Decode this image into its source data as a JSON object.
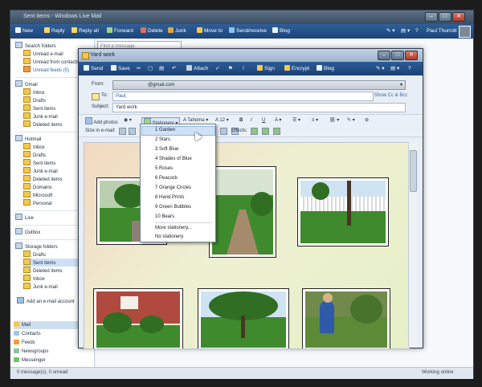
{
  "main_window": {
    "title": "Sent items - Windows Live Mail",
    "toolbar": [
      "New",
      "Reply",
      "Reply all",
      "Forward",
      "Delete",
      "Junk",
      "Move to",
      "Send/receive",
      "Blog"
    ],
    "user_name": "Paul Thurrott",
    "find_placeholder": "Find a message"
  },
  "sidebar": {
    "top": [
      "Search folders",
      "Unread e-mail",
      "Unread from contacts",
      "Unread feeds (5)"
    ],
    "gmail": [
      "Gmail",
      "Inbox",
      "Drafts",
      "Sent items",
      "Junk e-mail",
      "Deleted items"
    ],
    "hotmail": [
      "Hotmail",
      "Inbox",
      "Drafts",
      "Sent items",
      "Junk e-mail",
      "Deleted items",
      "Domains",
      "Microsoft",
      "Personal"
    ],
    "live": "Live",
    "outbox": "Outbox",
    "storage": [
      "Storage folders",
      "Drafts",
      "Sent items",
      "Deleted items",
      "Inbox",
      "Junk e-mail"
    ],
    "add_account": "Add an e-mail account",
    "nav": [
      "Mail",
      "Contacts",
      "Feeds",
      "Newsgroups",
      "Messenger"
    ]
  },
  "status": {
    "left": "0 message(s), 0 unread",
    "right": "Working online"
  },
  "compose": {
    "title": "Yard work",
    "toolbar": [
      "Send",
      "Save",
      "Attach",
      "Sign",
      "Encrypt",
      "Blog"
    ],
    "from_label": "From:",
    "from_value": "@gmail.com",
    "to_label": "To:",
    "to_value": "Paul;",
    "show_cc": "Show Cc & Bcc",
    "subject_label": "Subject:",
    "subject_value": "Yard work",
    "format_bar": {
      "add_photos": "Add photos",
      "stationery": "Stationery",
      "font": "Tahoma",
      "size": "12",
      "size_in_email": "Size in e-mail:",
      "effects": "Effects:"
    }
  },
  "stationery_menu": {
    "items": [
      "1 Garden",
      "2 Stars",
      "3 Soft Blue",
      "4 Shades of Blue",
      "5 Roses",
      "6 Peacock",
      "7 Orange Circles",
      "8 Hand Prints",
      "9 Green Bubbles",
      "10 Bears"
    ],
    "more": "More stationery...",
    "none": "No stationery",
    "highlighted": "1 Garden"
  }
}
